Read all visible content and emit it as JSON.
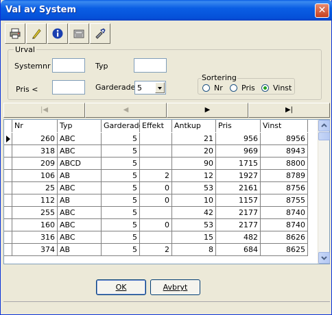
{
  "window": {
    "title": "Val av System",
    "close_glyph": "✕"
  },
  "toolbar": {
    "icons": [
      "printer-icon",
      "pencil-icon",
      "info-icon",
      "calculator-icon",
      "tools-icon"
    ]
  },
  "filter": {
    "group_label": "Urval",
    "systemnr_label": "Systemnr",
    "systemnr_value": "",
    "typ_label": "Typ",
    "typ_value": "",
    "pris_label": "Pris <",
    "pris_value": "",
    "garderade_label": "Garderade",
    "garderade_value": "5"
  },
  "sort": {
    "label": "Sortering",
    "options": [
      "Nr",
      "Pris",
      "Vinst"
    ],
    "selected": "Vinst"
  },
  "nav": {
    "first": "|◀",
    "prev": "◀",
    "next": "▶",
    "last": "▶|"
  },
  "grid": {
    "columns": [
      "Nr",
      "Typ",
      "Garderade",
      "Effekt",
      "Antkup",
      "Pris",
      "Vinst"
    ],
    "rows": [
      [
        "260",
        "ABC",
        "5",
        "",
        "21",
        "956",
        "8956"
      ],
      [
        "318",
        "ABC",
        "5",
        "",
        "20",
        "969",
        "8943"
      ],
      [
        "209",
        "ABCD",
        "5",
        "",
        "90",
        "1715",
        "8800"
      ],
      [
        "106",
        "AB",
        "5",
        "2",
        "12",
        "1927",
        "8789"
      ],
      [
        "25",
        "ABC",
        "5",
        "0",
        "53",
        "2161",
        "8756"
      ],
      [
        "112",
        "AB",
        "5",
        "0",
        "10",
        "1157",
        "8755"
      ],
      [
        "255",
        "ABC",
        "5",
        "",
        "42",
        "2177",
        "8740"
      ],
      [
        "160",
        "ABC",
        "5",
        "0",
        "53",
        "2177",
        "8740"
      ],
      [
        "316",
        "ABC",
        "5",
        "",
        "15",
        "482",
        "8626"
      ],
      [
        "374",
        "AB",
        "5",
        "2",
        "8",
        "684",
        "8625"
      ]
    ],
    "current_row": 0
  },
  "buttons": {
    "ok": "OK",
    "cancel": "Avbryt"
  },
  "colors": {
    "title_bar": "#0a5ee4",
    "radio_dot": "#21a121",
    "window_bg": "#ece9d8"
  }
}
